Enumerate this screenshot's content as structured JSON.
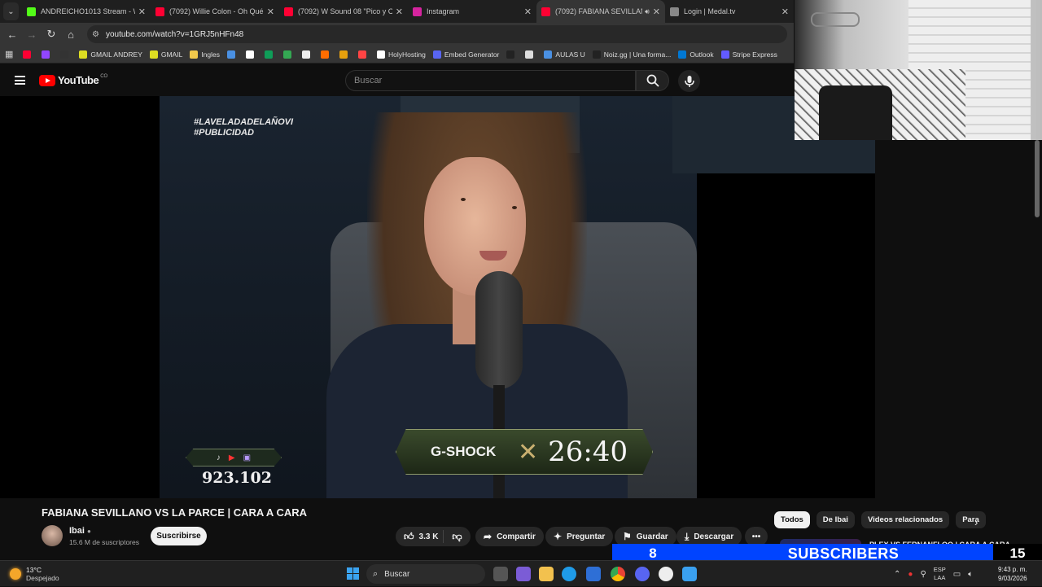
{
  "browser": {
    "tabs": [
      {
        "title": "ANDREICHO1013 Stream - Wat",
        "icon": "kick-icon",
        "color": "#53fc18"
      },
      {
        "title": "(7092) Willie Colon - Oh Qué Se",
        "icon": "youtube-icon",
        "color": "#ff0033"
      },
      {
        "title": "(7092) W Sound 08 \"Pico y Cha",
        "icon": "youtube-icon",
        "color": "#ff0033"
      },
      {
        "title": "Instagram",
        "icon": "instagram-icon",
        "color": "#d6249f"
      },
      {
        "title": "(7092) FABIANA SEVILLANO",
        "icon": "youtube-icon",
        "color": "#ff0033"
      },
      {
        "title": "Login | Medal.tv",
        "icon": "medal-icon",
        "color": "#888888"
      }
    ],
    "url": "youtube.com/watch?v=1GRJ5nHFn48",
    "bookmarks": [
      {
        "label": "",
        "color": "#ff0033"
      },
      {
        "label": "",
        "color": "#9146ff"
      },
      {
        "label": "",
        "color": "#333333"
      },
      {
        "label": "GMAIL ANDREY",
        "color": "#dddd22"
      },
      {
        "label": "GMAIL",
        "color": "#dddd22"
      },
      {
        "label": "Ingles",
        "color": "#f2c94c"
      },
      {
        "label": "",
        "color": "#4a90e2"
      },
      {
        "label": "",
        "color": "#ffffff"
      },
      {
        "label": "",
        "color": "#0f9d58"
      },
      {
        "label": "",
        "color": "#34a853"
      },
      {
        "label": "",
        "color": "#eeeeee"
      },
      {
        "label": "",
        "color": "#ff6d00"
      },
      {
        "label": "",
        "color": "#e5a00d"
      },
      {
        "label": "",
        "color": "#ff4444"
      },
      {
        "label": "HolyHosting",
        "color": "#ffffff"
      },
      {
        "label": "Embed Generator",
        "color": "#5865f2"
      },
      {
        "label": "",
        "color": "#222222"
      },
      {
        "label": "",
        "color": "#dddddd"
      },
      {
        "label": "AULAS U",
        "color": "#4a90e2"
      },
      {
        "label": "Noiz.gg | Una forma...",
        "color": "#222222"
      },
      {
        "label": "Outlook",
        "color": "#0078d4"
      },
      {
        "label": "Stripe Express",
        "color": "#635bff"
      }
    ]
  },
  "youtube": {
    "logo_text": "YouTube",
    "country": "CO",
    "search_placeholder": "Buscar",
    "video": {
      "hashtags": [
        "#LAVELADADELAÑOVI",
        "#PUBLICIDAD"
      ],
      "viewers": "923.102",
      "sponsor": "G-SHOCK",
      "timer": "26:40",
      "title": "FABIANA SEVILLANO VS LA PARCE | CARA A CARA"
    },
    "channel": {
      "name": "Ibai",
      "subscribers": "15.6 M de suscriptores",
      "subscribe_label": "Suscribirse"
    },
    "actions": {
      "likes": "3.3 K",
      "share": "Compartir",
      "ask": "Preguntar",
      "save": "Guardar",
      "download": "Descargar"
    },
    "chips": [
      {
        "label": "Todos",
        "selected": true
      },
      {
        "label": "De Ibai",
        "selected": false
      },
      {
        "label": "Videos relacionados",
        "selected": false
      },
      {
        "label": "Para",
        "selected": false
      }
    ],
    "next_video_title": "PLEX VS FERNANFLOO | CARA A CARA"
  },
  "overlay": {
    "left_value": "8",
    "center_text": "SUBSCRIBERS",
    "right_value": "15"
  },
  "taskbar": {
    "weather_temp": "13°C",
    "weather_desc": "Despejado",
    "search_label": "Buscar",
    "lang_top": "ESP",
    "lang_bottom": "LAA",
    "time": "9:43 p. m.",
    "date": "9/03/2026"
  }
}
